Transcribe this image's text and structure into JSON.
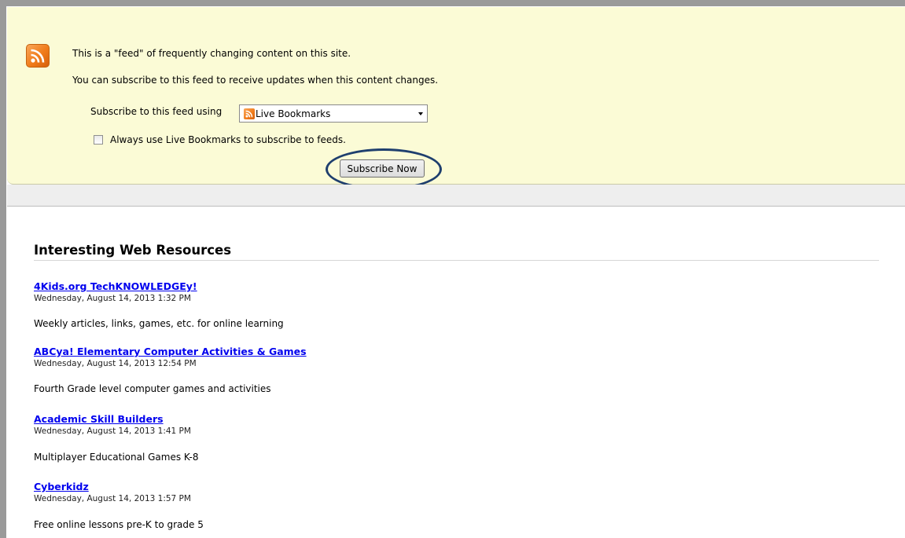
{
  "feed_header": {
    "intro_line1": "This is a \"feed\" of frequently changing content on this site.",
    "intro_line2": "You can subscribe to this feed to receive updates when this content changes.",
    "subscribe_label": "Subscribe to this feed using",
    "reader_selected": "Live Bookmarks",
    "always_use_label": "Always use Live Bookmarks to subscribe to feeds.",
    "always_use_checked": false,
    "subscribe_button": "Subscribe Now"
  },
  "feed": {
    "title": "Interesting Web Resources",
    "entries": [
      {
        "title": "4Kids.org TechKNOWLEDGEy!",
        "date": "Wednesday, August 14, 2013 1:32 PM",
        "description": "Weekly articles, links, games, etc. for online learning"
      },
      {
        "title": "ABCya! Elementary Computer Activities & Games",
        "date": "Wednesday, August 14, 2013 12:54 PM",
        "description": "Fourth Grade level computer games and activities"
      },
      {
        "title": "Academic Skill Builders",
        "date": "Wednesday, August 14, 2013 1:41 PM",
        "description": "Multiplayer Educational Games K-8"
      },
      {
        "title": "Cyberkidz",
        "date": "Wednesday, August 14, 2013 1:57 PM",
        "description": "Free online lessons pre-K to grade 5"
      }
    ]
  },
  "colors": {
    "header_bg": "#fbfbd6",
    "link": "#0000ee",
    "highlight_ring": "#1f3f6e",
    "rss_orange": "#f07b1a"
  }
}
